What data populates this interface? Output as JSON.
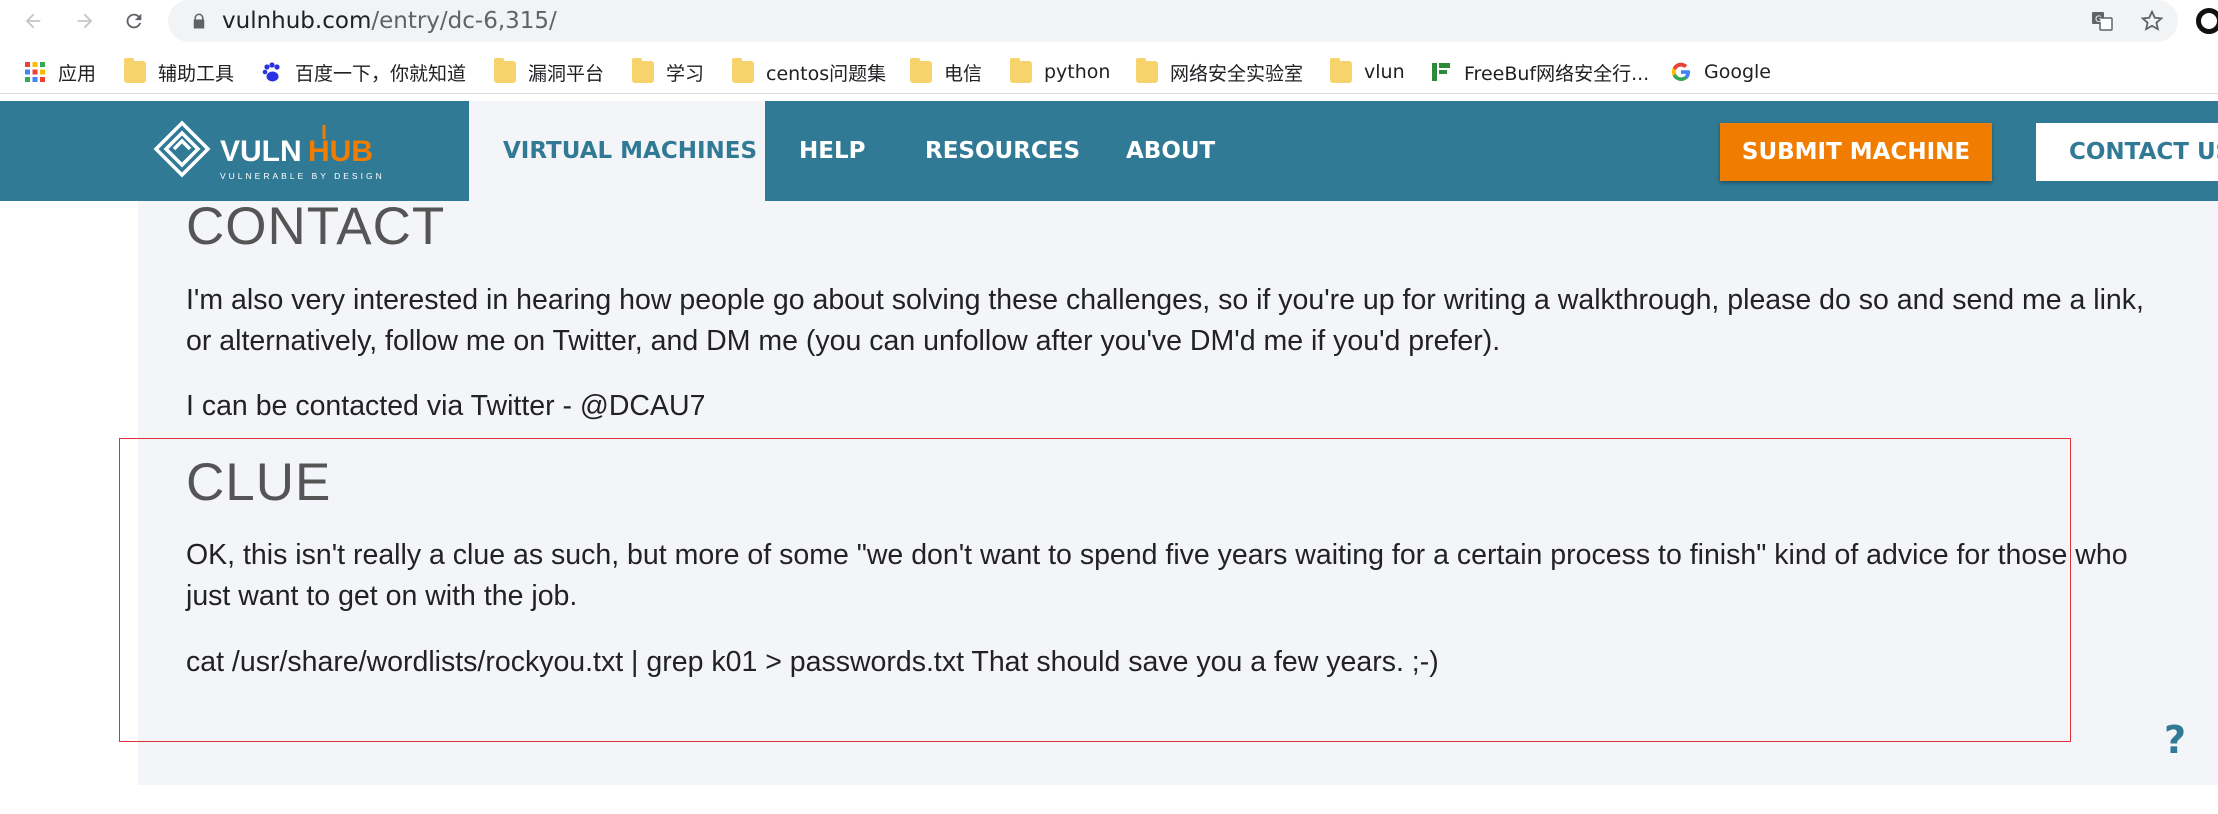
{
  "browser": {
    "url_host": "vulnhub.com",
    "url_path": "/entry/dc-6,315/"
  },
  "bookmarks": [
    {
      "label": "应用",
      "icon": "apps-grid-icon"
    },
    {
      "label": "辅助工具",
      "icon": "folder-icon"
    },
    {
      "label": "百度一下，你就知道",
      "icon": "baidu-paw-icon"
    },
    {
      "label": "漏洞平台",
      "icon": "folder-icon"
    },
    {
      "label": "学习",
      "icon": "folder-icon"
    },
    {
      "label": "centos问题集",
      "icon": "folder-icon"
    },
    {
      "label": "电信",
      "icon": "folder-icon"
    },
    {
      "label": "python",
      "icon": "folder-icon"
    },
    {
      "label": "网络安全实验室",
      "icon": "folder-icon"
    },
    {
      "label": "vlun",
      "icon": "folder-icon"
    },
    {
      "label": "FreeBuf网络安全行...",
      "icon": "freebuf-icon"
    },
    {
      "label": "Google",
      "icon": "google-icon"
    }
  ],
  "header": {
    "logo_text": "VULNHUB",
    "logo_tagline": "VULNERABLE BY DESIGN",
    "nav": [
      {
        "label": "VIRTUAL MACHINES",
        "active": true
      },
      {
        "label": "HELP",
        "active": false
      },
      {
        "label": "RESOURCES",
        "active": false
      },
      {
        "label": "ABOUT",
        "active": false
      }
    ],
    "submit_label": "SUBMIT MACHINE",
    "contact_label": "CONTACT US",
    "colors": {
      "bar": "#317a95",
      "submit": "#f07d00",
      "active_bg": "#f4f5f9"
    }
  },
  "content": {
    "contact_heading": "CONTACT",
    "contact_para1": "I'm also very interested in hearing how people go about solving these challenges, so if you're up for writing a walkthrough, please do so and send me a link, or alternatively, follow me on Twitter, and DM me (you can unfollow after you've DM'd me if you'd prefer).",
    "contact_para2": "I can be contacted via Twitter - @DCAU7",
    "clue_heading": "CLUE",
    "clue_para1": "OK, this isn't really a clue as such, but more of some \"we don't want to spend five years waiting for a certain process to finish\" kind of advice for those who just want to get on with the job.",
    "clue_para2": "cat /usr/share/wordlists/rockyou.txt | grep k01 > passwords.txt That should save you a few years. ;-)",
    "highlight_color": "#e0303a"
  },
  "help_button_label": "?"
}
